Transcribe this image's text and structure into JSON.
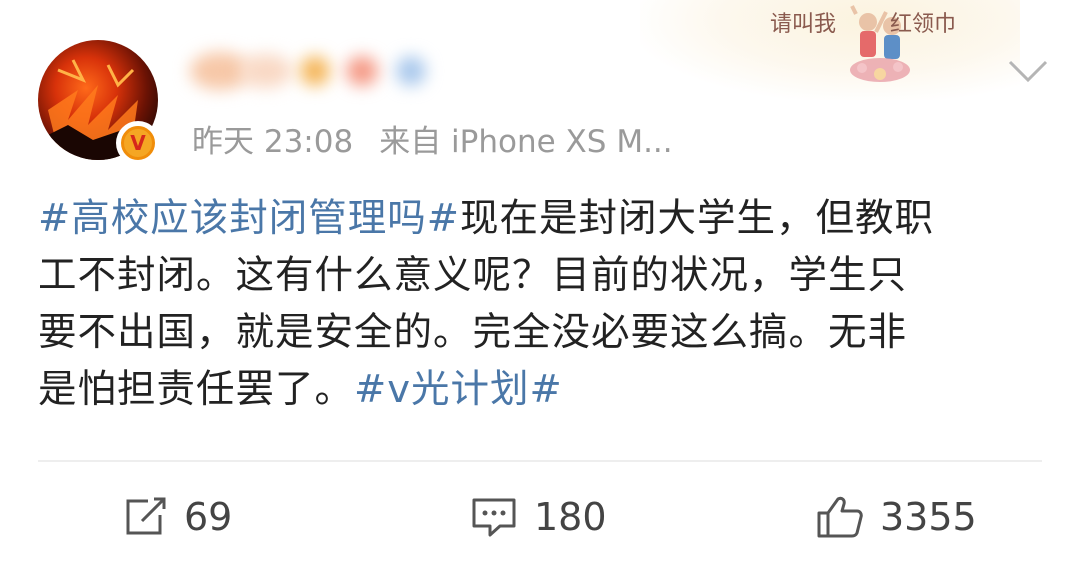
{
  "banner": {
    "text_left": "请叫我",
    "text_right": "红领巾"
  },
  "post": {
    "time": "昨天 23:08",
    "source": "来自 iPhone XS M...",
    "hashtag1": "#高校应该封闭管理吗#",
    "line1_rest": "现在是封闭大学生，但教职",
    "line2": "工不封闭。这有什么意义呢？目前的状况，学生只",
    "line3": "要不出国，就是安全的。完全没必要这么搞。无非",
    "line4_text": "是怕担责任罢了。",
    "hashtag2": "#v光计划#"
  },
  "actions": {
    "repost_count": "69",
    "comment_count": "180",
    "like_count": "3355"
  },
  "colors": {
    "link": "#4a77a8",
    "meta": "#9a9a9a",
    "badge": "#f5a623"
  }
}
